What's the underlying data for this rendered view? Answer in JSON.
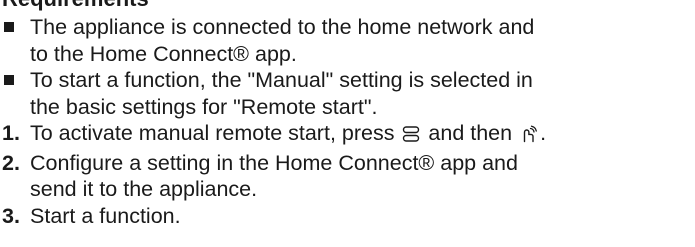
{
  "heading": "Requirements",
  "requirements": [
    {
      "line1": "The appliance is connected to the home network and",
      "line2": "to the Home Connect® app."
    },
    {
      "line1": "To start a function, the \"Manual\" setting is selected in",
      "line2": "the basic settings for \"Remote start\"."
    }
  ],
  "steps": [
    {
      "number": "1.",
      "before_first_icon": "To activate manual remote start, press ",
      "first_icon": "menu-lines-icon",
      "between_icons": " and then ",
      "second_icon": "remote-start-icon",
      "after_second_icon": "."
    },
    {
      "number": "2.",
      "line1": "Configure a setting in the Home Connect® app and",
      "line2": "send it to the appliance."
    },
    {
      "number": "3.",
      "text": "Start a function."
    }
  ]
}
